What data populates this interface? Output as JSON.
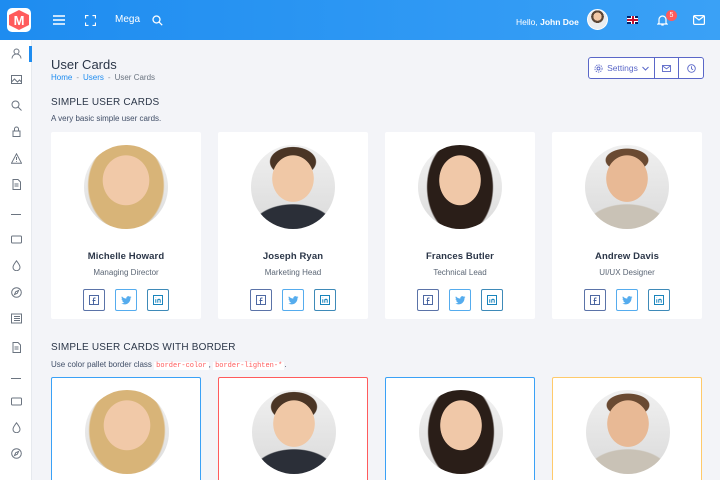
{
  "app": {
    "logo_letter": "M"
  },
  "header": {
    "mega_label": "Mega",
    "hello_label": "Hello,",
    "user_name": "John Doe",
    "notification_count": "5"
  },
  "page": {
    "title": "User Cards",
    "breadcrumb": [
      "Home",
      "Users",
      "User Cards"
    ],
    "settings_label": "Settings"
  },
  "section1": {
    "title": "SIMPLE USER CARDS",
    "subtitle": "A very basic simple user cards."
  },
  "section2": {
    "title": "SIMPLE USER CARDS WITH BORDER",
    "subtitle_prefix": "Use color pallet border class",
    "code1": "border-color",
    "comma": ",",
    "code2": "border-lighten-*",
    "period": "."
  },
  "users": [
    {
      "name": "Michelle Howard",
      "role": "Managing Director"
    },
    {
      "name": "Joseph Ryan",
      "role": "Marketing Head"
    },
    {
      "name": "Frances Butler",
      "role": "Technical Lead"
    },
    {
      "name": "Andrew Davis",
      "role": "UI/UX Designer"
    }
  ],
  "border_colors": [
    "#3aa1f6",
    "#ff5b5c",
    "#3aa1f6",
    "#ffca6b"
  ],
  "colors": {
    "primary": "#1e8cf0",
    "accent": "#5a67c8",
    "danger": "#ff5b5c"
  },
  "icons": {
    "sidebar": [
      "user-icon",
      "image-icon",
      "search-icon",
      "lock-icon",
      "warning-icon",
      "document-icon",
      "card-icon",
      "drop-icon",
      "compass-icon",
      "list-icon",
      "document-icon",
      "card-icon",
      "drop-icon",
      "compass-icon"
    ],
    "social": [
      "facebook-icon",
      "twitter-icon",
      "linkedin-icon"
    ]
  }
}
